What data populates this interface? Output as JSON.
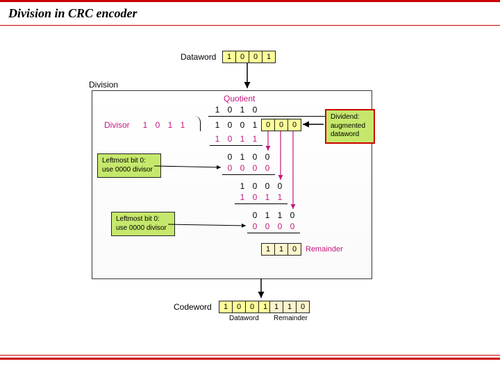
{
  "title": "Division in CRC encoder",
  "labels": {
    "dataword": "Dataword",
    "division": "Division",
    "quotient": "Quotient",
    "divisor": "Divisor",
    "dividend": "Dividend:\naugmented\ndataword",
    "leftmost": "Leftmost bit 0:\nuse 0000 divisor",
    "remainder": "Remainder",
    "codeword": "Codeword",
    "foot_dataword": "Dataword",
    "foot_remainder": "Remainder"
  },
  "dataword_bits": [
    "1",
    "0",
    "0",
    "1"
  ],
  "quotient_bits": [
    "1",
    "0",
    "1",
    "0"
  ],
  "divisor_bits": [
    "1",
    "0",
    "1",
    "1"
  ],
  "dividend_bits": [
    "1",
    "0",
    "0",
    "1",
    "0",
    "0",
    "0"
  ],
  "rows": {
    "r1": [
      "1",
      "0",
      "1",
      "1"
    ],
    "r2": [
      "0",
      "1",
      "0",
      "0"
    ],
    "r3": [
      "0",
      "0",
      "0",
      "0"
    ],
    "r4": [
      "1",
      "0",
      "0",
      "0"
    ],
    "r5": [
      "1",
      "0",
      "1",
      "1"
    ],
    "r6": [
      "0",
      "1",
      "1",
      "0"
    ],
    "r7": [
      "0",
      "0",
      "0",
      "0"
    ]
  },
  "remainder_bits": [
    "1",
    "1",
    "0"
  ],
  "codeword_data": [
    "1",
    "0",
    "0",
    "1"
  ],
  "codeword_rem": [
    "1",
    "1",
    "0"
  ]
}
